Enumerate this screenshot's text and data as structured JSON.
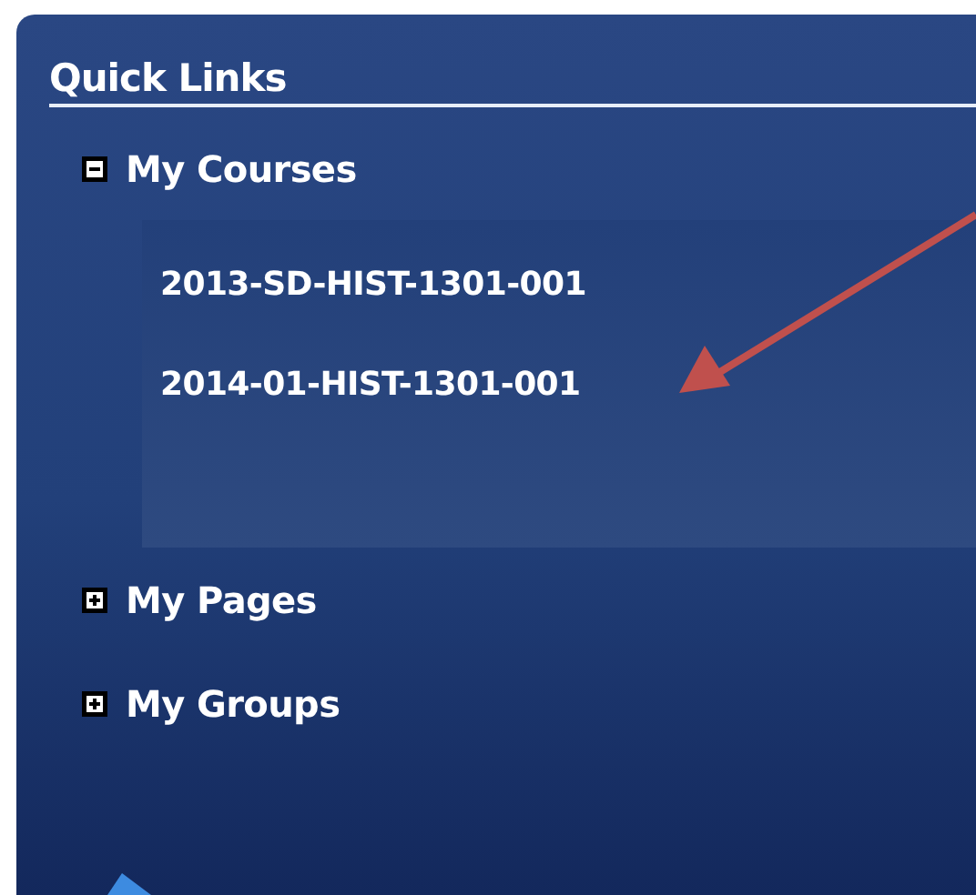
{
  "title": "Quick Links",
  "sections": [
    {
      "label": "My Courses",
      "expanded": true,
      "children": [
        {
          "label": "2013-SD-HIST-1301-001"
        },
        {
          "label": "2014-01-HIST-1301-001"
        }
      ]
    },
    {
      "label": "My Pages",
      "expanded": false
    },
    {
      "label": "My Groups",
      "expanded": false
    }
  ]
}
